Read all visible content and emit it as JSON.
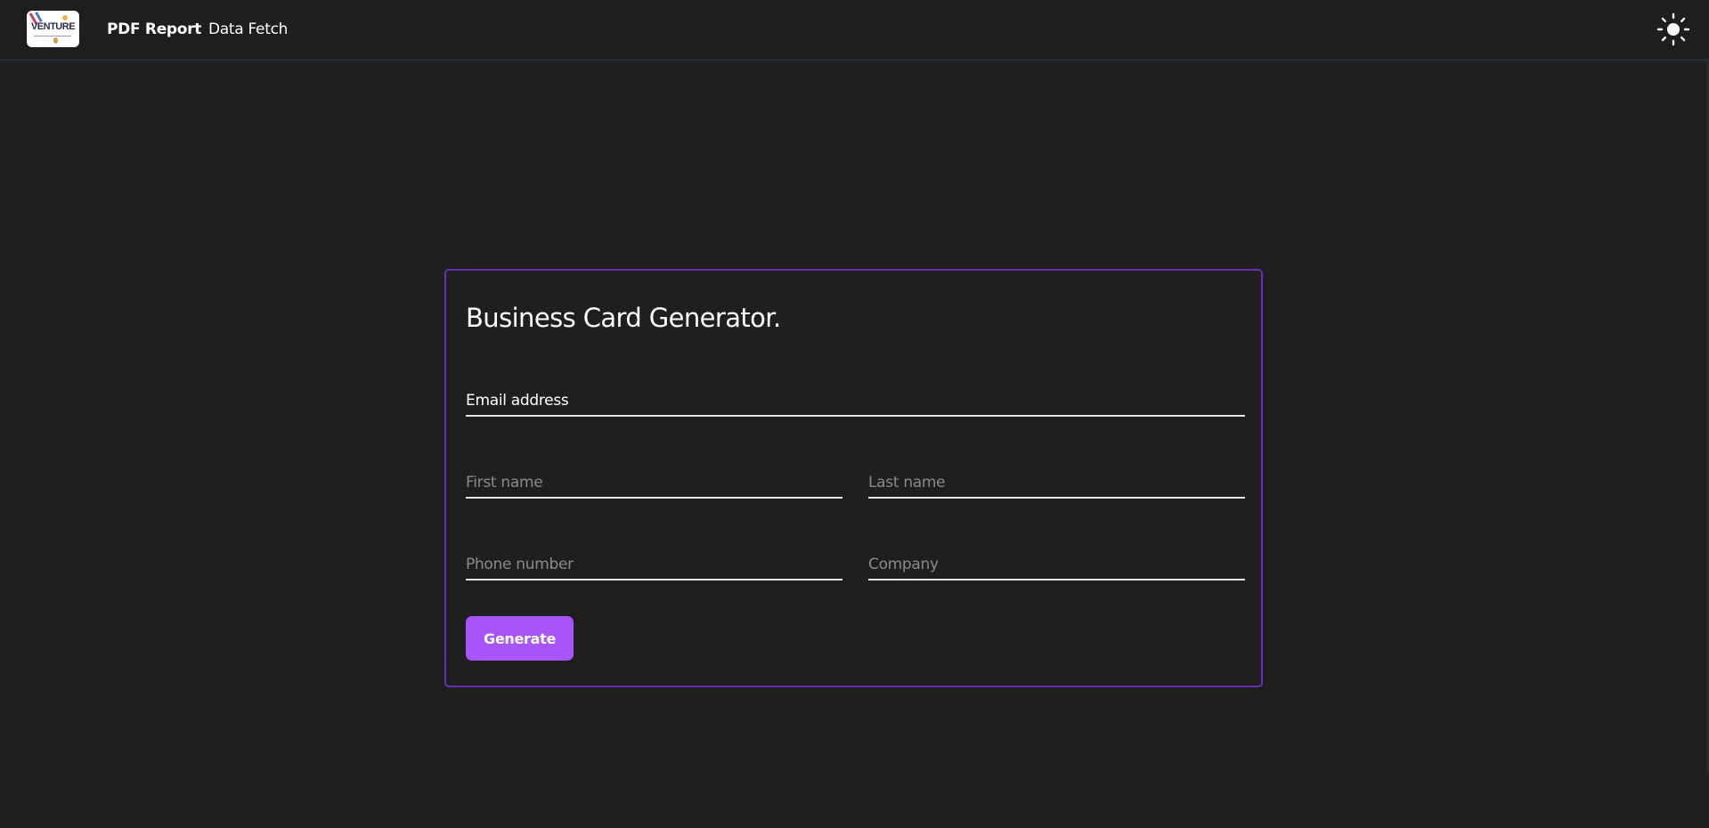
{
  "nav": {
    "logo_text": "VENTURE",
    "links": [
      {
        "label": "PDF Report",
        "active": true
      },
      {
        "label": "Data Fetch",
        "active": false
      }
    ],
    "theme_icon": "sun-icon"
  },
  "form": {
    "title": "Business Card Generator.",
    "fields": {
      "email": {
        "placeholder": "Email address",
        "value": ""
      },
      "first_name": {
        "placeholder": "First name",
        "value": ""
      },
      "last_name": {
        "placeholder": "Last name",
        "value": ""
      },
      "phone": {
        "placeholder": "Phone number",
        "value": ""
      },
      "company": {
        "placeholder": "Company",
        "value": ""
      }
    },
    "submit_label": "Generate"
  },
  "colors": {
    "background": "#1f1f1f",
    "accent": "#a855f7",
    "card_border": "#6b2fb3"
  }
}
